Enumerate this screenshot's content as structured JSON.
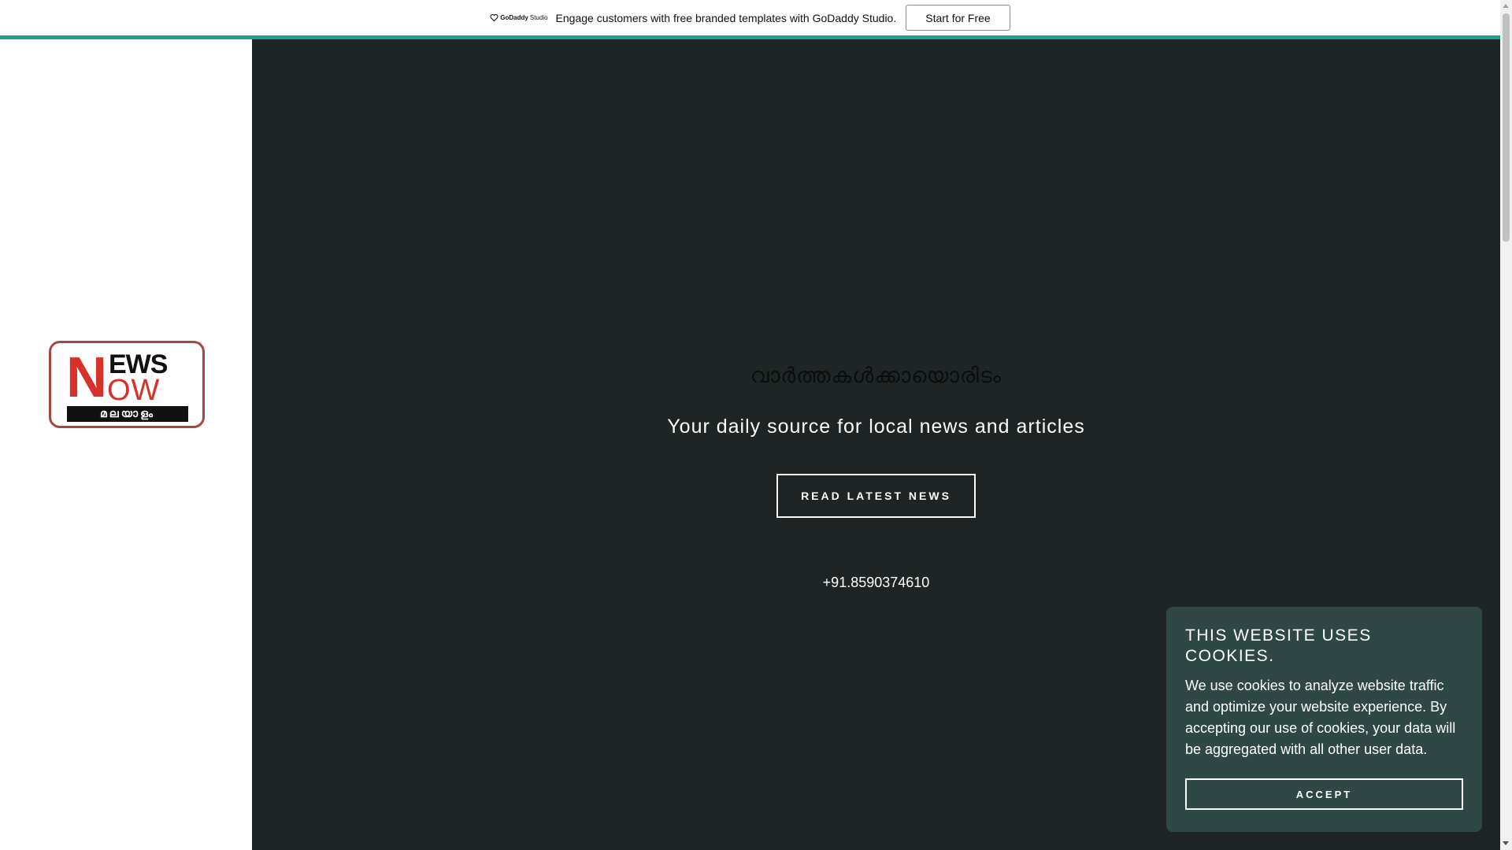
{
  "promo": {
    "brand_name": "GoDaddy",
    "brand_suffix": "Studio",
    "message": "Engage customers with free branded templates with GoDaddy Studio.",
    "cta_label": "Start for Free"
  },
  "logo": {
    "letter_n": "N",
    "letters_ews": "EWS",
    "letters_ow": "OW",
    "malayalam_strip": "മലയാളം"
  },
  "hero": {
    "title": "വാർത്തകൾക്കായൊരിടം",
    "tagline": "Your daily source for local news and articles",
    "cta_label": "READ LATEST NEWS",
    "phone": "+91.8590374610"
  },
  "cookie": {
    "title": "THIS WEBSITE USES COOKIES.",
    "body": "We use cookies to analyze website traffic and optimize your website experience. By accepting our use of cookies, your data will be aggregated with all other user data.",
    "accept_label": "ACCEPT"
  },
  "colors": {
    "hero_background": "#1e2524",
    "cookie_background": "#2f4846",
    "accent_teal": "#1f9e93",
    "logo_red": "#d6322a"
  }
}
